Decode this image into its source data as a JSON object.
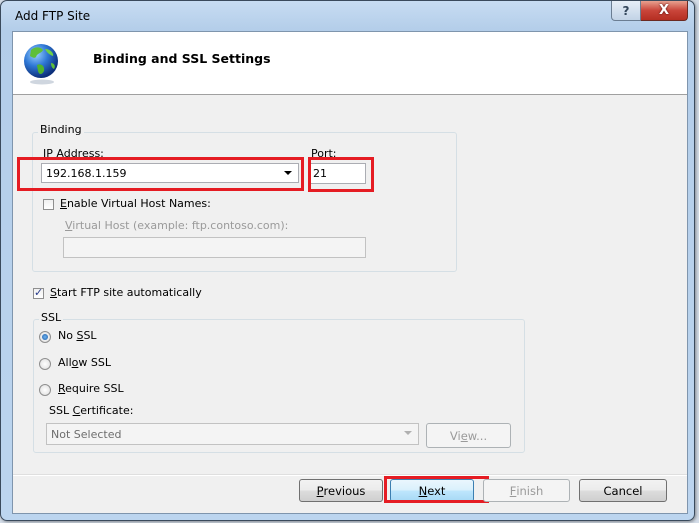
{
  "window": {
    "title": "Add FTP Site",
    "help_label": "?",
    "close_label": "X"
  },
  "header": {
    "icon": "globe-icon",
    "title": "Binding and SSL Settings"
  },
  "binding": {
    "legend": "Binding",
    "ip_label": "IP Address:",
    "ip_value": "192.168.1.159",
    "port_label": "Port:",
    "port_value": "21",
    "enable_vhost_label": "Enable Virtual Host Names:",
    "enable_vhost_checked": false,
    "vhost_label": "Virtual Host (example: ftp.contoso.com):",
    "vhost_value": ""
  },
  "start_auto": {
    "label": "Start FTP site automatically",
    "checked": true
  },
  "ssl": {
    "legend": "SSL",
    "options": [
      {
        "label": "No SSL",
        "selected": true
      },
      {
        "label": "Allow SSL",
        "selected": false
      },
      {
        "label": "Require SSL",
        "selected": false
      }
    ],
    "cert_label": "SSL Certificate:",
    "cert_value": "Not Selected",
    "view_label": "View..."
  },
  "buttons": {
    "previous": "Previous",
    "next": "Next",
    "finish": "Finish",
    "cancel": "Cancel"
  },
  "colors": {
    "highlight": "#e51c23"
  }
}
